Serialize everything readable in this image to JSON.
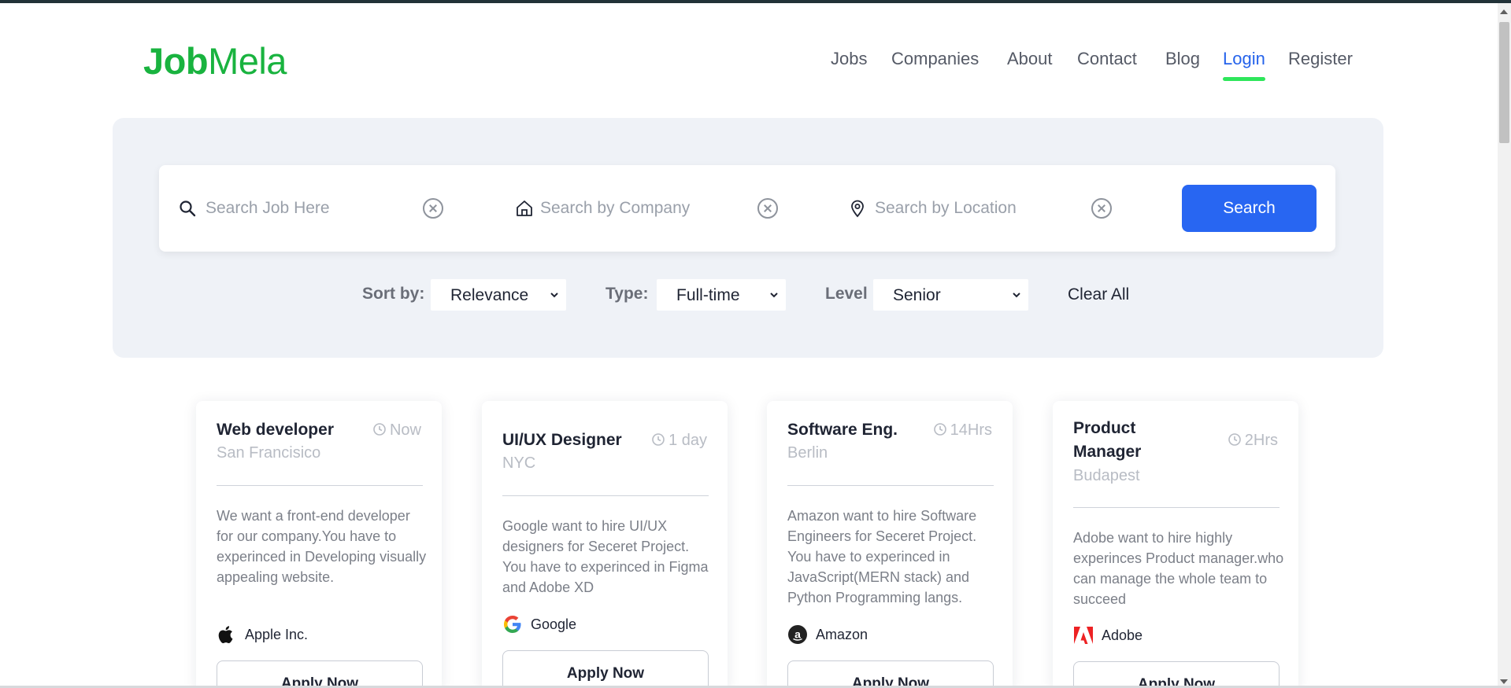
{
  "brand": {
    "logo_bold": "Job",
    "logo_light": "Mela"
  },
  "nav": {
    "items": [
      {
        "label": "Jobs"
      },
      {
        "label": "Companies"
      },
      {
        "label": "About"
      },
      {
        "label": "Contact"
      },
      {
        "label": "Blog"
      },
      {
        "label": "Login",
        "active": true
      },
      {
        "label": "Register"
      }
    ]
  },
  "search": {
    "job_placeholder": "Search Job Here",
    "company_placeholder": "Search by Company",
    "location_placeholder": "Search by Location",
    "button_label": "Search",
    "icons": [
      "search-icon",
      "home-icon",
      "location-pin-icon",
      "clear-circle-x-icon"
    ]
  },
  "filters": {
    "sort_label": "Sort by:",
    "sort_value": "Relevance",
    "type_label": "Type:",
    "type_value": "Full-time",
    "level_label": "Level",
    "level_value": "Senior",
    "clear_all": "Clear All"
  },
  "jobs": [
    {
      "title": "Web developer",
      "time": "Now",
      "location": "San Francisico",
      "description": "We want a front-end developer for our company.You have to experinced in Developing visually appealing website.",
      "company": "Apple Inc.",
      "apply": "Apply Now"
    },
    {
      "title": "UI/UX Designer",
      "time": "1 day",
      "location": "NYC",
      "description": "Google want to hire UI/UX designers for Seceret Project. You have to experinced in Figma and Adobe XD",
      "company": "Google",
      "apply": "Apply Now"
    },
    {
      "title": "Software Eng.",
      "time": "14Hrs",
      "location": "Berlin",
      "description": "Amazon want to hire Software Engineers for Seceret Project. You have to experinced in JavaScript(MERN stack) and Python Programming langs.",
      "company": "Amazon",
      "apply": "Apply Now"
    },
    {
      "title": "Product Manager",
      "time": "2Hrs",
      "location": "Budapest",
      "description": "Adobe want to hire highly experinces Product manager.who can manage the whole team to succeed",
      "company": "Adobe",
      "apply": "Apply Now"
    }
  ],
  "colors": {
    "brand_green": "#19b33f",
    "primary_blue": "#2866f2",
    "active_underline": "#2ee65b",
    "panel_bg": "#eff2f7"
  }
}
